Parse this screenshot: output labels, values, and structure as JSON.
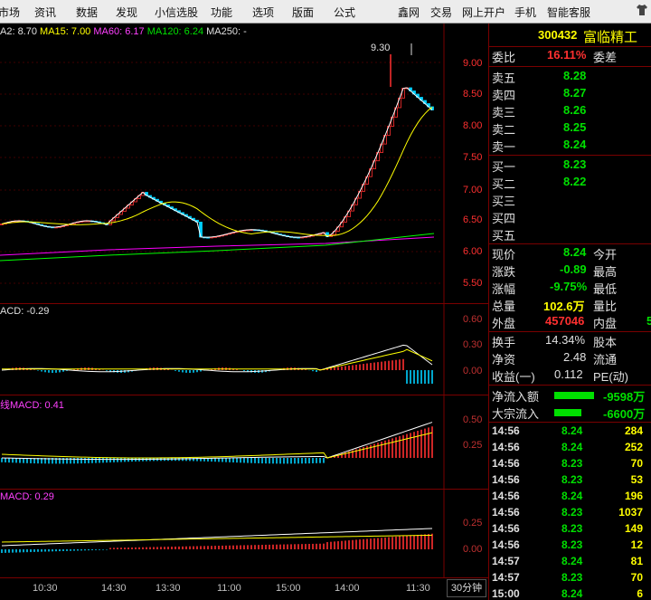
{
  "menu": [
    "市场",
    "资讯",
    "数据",
    "发现",
    "小信选股",
    "功能",
    "选项",
    "版面",
    "公式",
    "鑫网",
    "交易",
    "网上开户",
    "手机",
    "智能客服"
  ],
  "stock": {
    "code": "300432",
    "name": "富临精工"
  },
  "ma_legend": {
    "ma2": "A2: 8.70",
    "ma15": "MA15: 7.00",
    "ma60": "MA60: 6.17",
    "ma120": "MA120: 6.24",
    "ma250": "MA250: -"
  },
  "price_axis": [
    "9.00",
    "8.50",
    "8.00",
    "7.50",
    "7.00",
    "6.50",
    "6.00",
    "5.50"
  ],
  "high_label": "9.30",
  "macd1_label": "ACD: -0.29",
  "macd1_axis": [
    "0.60",
    "0.30",
    "0.00"
  ],
  "macd2_label": "线MACD: 0.41",
  "macd2_axis": [
    "0.50",
    "0.25"
  ],
  "macd3_label": "MACD: 0.29",
  "macd3_axis": [
    "0.25",
    "0.00"
  ],
  "time_axis": [
    "10:30",
    "14:30",
    "13:30",
    "11:00",
    "15:00",
    "14:00",
    "11:30"
  ],
  "period": "30分钟",
  "colors": {
    "up": "#ff3030",
    "down": "#00d0ff",
    "ma2": "#ffffff",
    "ma15": "#ffff00",
    "ma60": "#ff00ff",
    "ma120": "#00ff00"
  },
  "quote": {
    "weibi_label": "委比",
    "weibi_value": "16.11%",
    "weicha_label": "委差",
    "asks": [
      {
        "label": "卖五",
        "price": "8.28"
      },
      {
        "label": "卖四",
        "price": "8.27"
      },
      {
        "label": "卖三",
        "price": "8.26"
      },
      {
        "label": "卖二",
        "price": "8.25"
      },
      {
        "label": "卖一",
        "price": "8.24"
      }
    ],
    "bids": [
      {
        "label": "买一",
        "price": "8.23"
      },
      {
        "label": "买二",
        "price": "8.22"
      },
      {
        "label": "买三",
        "price": ""
      },
      {
        "label": "买四",
        "price": ""
      },
      {
        "label": "买五",
        "price": ""
      }
    ],
    "stats": [
      {
        "l1": "现价",
        "v1": "8.24",
        "l2": "今开"
      },
      {
        "l1": "涨跌",
        "v1": "-0.89",
        "l2": "最高"
      },
      {
        "l1": "涨幅",
        "v1": "-9.75%",
        "l2": "最低"
      },
      {
        "l1": "总量",
        "v1": "102.6万",
        "l2": "量比"
      },
      {
        "l1": "外盘",
        "v1": "457046",
        "l2": "内盘",
        "v2": "5"
      }
    ],
    "stats2": [
      {
        "l1": "换手",
        "v1": "14.34%",
        "l2": "股本"
      },
      {
        "l1": "净资",
        "v1": "2.48",
        "l2": "流通"
      },
      {
        "l1": "收益(一)",
        "v1": "0.112",
        "l2": "PE(动)"
      }
    ],
    "flows": [
      {
        "label": "净流入额",
        "value": "-9598万"
      },
      {
        "label": "大宗流入",
        "value": "-6600万"
      }
    ]
  },
  "ticks": [
    {
      "time": "14:56",
      "price": "8.24",
      "vol": "284"
    },
    {
      "time": "14:56",
      "price": "8.24",
      "vol": "252"
    },
    {
      "time": "14:56",
      "price": "8.23",
      "vol": "70"
    },
    {
      "time": "14:56",
      "price": "8.23",
      "vol": "53"
    },
    {
      "time": "14:56",
      "price": "8.24",
      "vol": "196"
    },
    {
      "time": "14:56",
      "price": "8.23",
      "vol": "1037"
    },
    {
      "time": "14:56",
      "price": "8.23",
      "vol": "149"
    },
    {
      "time": "14:56",
      "price": "8.23",
      "vol": "12"
    },
    {
      "time": "14:57",
      "price": "8.24",
      "vol": "81"
    },
    {
      "time": "14:57",
      "price": "8.23",
      "vol": "70"
    },
    {
      "time": "15:00",
      "price": "8.24",
      "vol": "6"
    }
  ]
}
